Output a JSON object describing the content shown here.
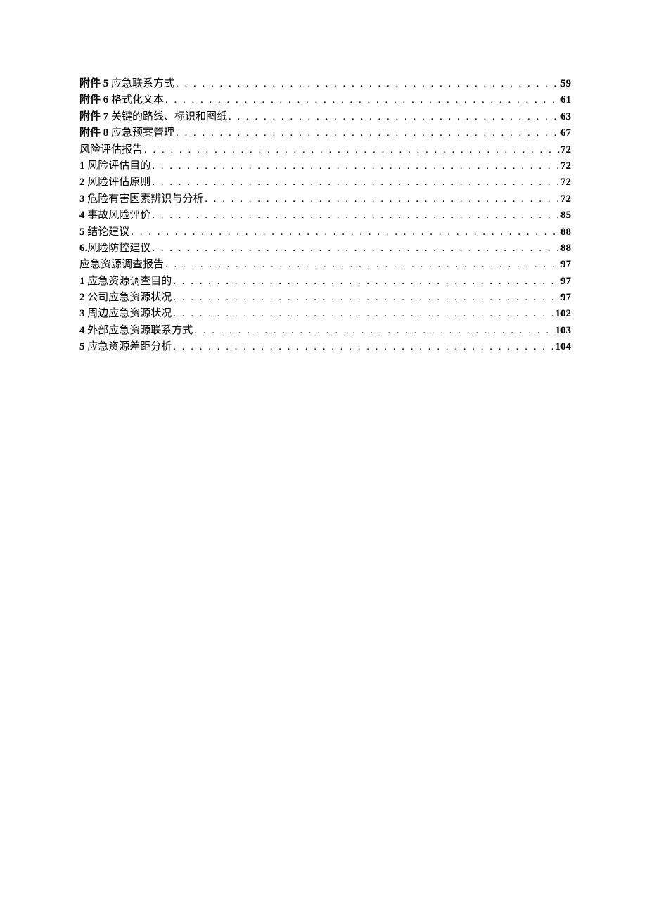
{
  "toc": {
    "entries": [
      {
        "num": "附件 5 ",
        "title": "应急联系方式",
        "page": "59"
      },
      {
        "num": "附件 6 ",
        "title": "格式化文本",
        "page": "61"
      },
      {
        "num": "附件 7 ",
        "title": "关键的路线、标识和图纸",
        "page": "63"
      },
      {
        "num": "附件 8 ",
        "title": "应急预案管理",
        "page": "67"
      },
      {
        "num": "",
        "title": "风险评估报告",
        "page": "72"
      },
      {
        "num": "1 ",
        "title": "风险评估目的",
        "page": "72"
      },
      {
        "num": "2 ",
        "title": "风险评估原则",
        "page": "72"
      },
      {
        "num": "3 ",
        "title": "危险有害因素辨识与分析",
        "page": "72"
      },
      {
        "num": "4 ",
        "title": "事故风险评价",
        "page": "85"
      },
      {
        "num": "5 ",
        "title": "结论建议",
        "page": "88"
      },
      {
        "num": "6.",
        "title": "风险防控建议",
        "page": "88"
      },
      {
        "num": "",
        "title": "应急资源调查报告",
        "page": "97"
      },
      {
        "num": "1 ",
        "title": "应急资源调查目的",
        "page": "97"
      },
      {
        "num": "2 ",
        "title": "公司应急资源状况",
        "page": "97"
      },
      {
        "num": "3 ",
        "title": "周边应急资源状况",
        "page": "102"
      },
      {
        "num": "4 ",
        "title": "外部应急资源联系方式",
        "page": "103"
      },
      {
        "num": "5 ",
        "title": "应急资源差距分析",
        "page": "104"
      }
    ]
  }
}
